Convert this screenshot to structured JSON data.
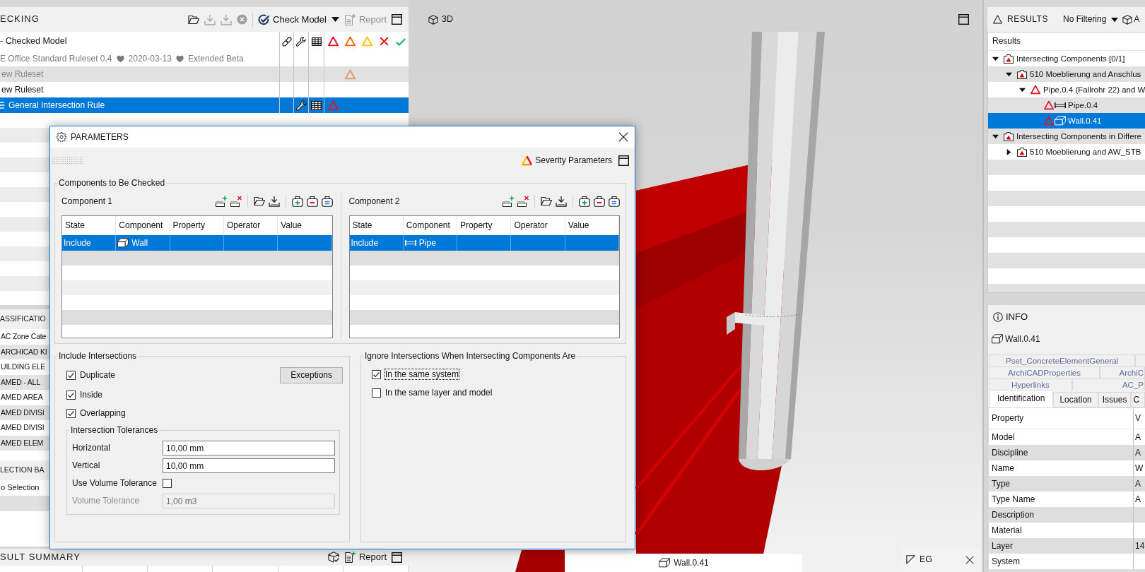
{
  "checking": {
    "title": "ECKING",
    "check_button": "Check Model",
    "report_button": "Report",
    "report_disabled": true,
    "header_label": "- Checked Model",
    "rows": [
      {
        "kind": "info",
        "parts": [
          "E Office Standard Ruleset 0.4",
          "2020-03-13",
          "Extended Beta"
        ],
        "selected": false,
        "disabled": false,
        "configured": false,
        "has_table": false
      },
      {
        "kind": "ruleset",
        "label": "ew Ruleset",
        "selected": false,
        "disabled": true,
        "configured": false,
        "has_table": false,
        "issue": {
          "kind": "warning"
        }
      },
      {
        "kind": "ruleset",
        "label": "ew Ruleset",
        "selected": false,
        "disabled": false,
        "configured": false,
        "has_table": false
      },
      {
        "kind": "rule",
        "label": "General Intersection Rule",
        "selected": true,
        "disabled": false,
        "configured": true,
        "has_table": true,
        "issue": {
          "kind": "error"
        }
      }
    ]
  },
  "classification": {
    "title": "ASSIFICATIO",
    "items": [
      "AC Zone Cate",
      "ARCHICAD KI",
      "UILDING ELE",
      "AMED - ALL",
      "AMED AREA",
      "AMED DIVISI",
      "AMED DIVISI",
      "AMED ELEM"
    ]
  },
  "selection_basket": {
    "title": "LECTION BA",
    "items": [
      "o Selection"
    ]
  },
  "result_summary": {
    "title": "SULT SUMMARY",
    "report_button": "Report"
  },
  "parameters": {
    "title": "PARAMETERS",
    "severity_button": "Severity Parameters",
    "components_title": "Components to Be Checked",
    "components": [
      {
        "title": "Component 1",
        "columns": [
          "State",
          "Component",
          "Property",
          "Operator",
          "Value"
        ],
        "rows": [
          {
            "state": "Include",
            "component": "Wall",
            "kind": "wall",
            "selected": true
          }
        ]
      },
      {
        "title": "Component 2",
        "columns": [
          "State",
          "Component",
          "Property",
          "Operator",
          "Value"
        ],
        "rows": [
          {
            "state": "Include",
            "component": "Pipe",
            "kind": "pipe",
            "selected": true
          }
        ]
      }
    ],
    "include": {
      "title": "Include Intersections",
      "options": [
        {
          "label": "Duplicate",
          "checked": true
        },
        {
          "label": "Inside",
          "checked": true
        },
        {
          "label": "Overlapping",
          "checked": true
        }
      ],
      "exceptions_button": "Exceptions",
      "tolerances": {
        "title": "Intersection Tolerances",
        "fields": [
          {
            "kind": "text",
            "label": "Horizontal",
            "value": "10,00 mm",
            "disabled": false
          },
          {
            "kind": "text",
            "label": "Vertical",
            "value": "10,00 mm",
            "disabled": false
          },
          {
            "kind": "checkbox",
            "label": "Use Volume Tolerance",
            "checked": false,
            "disabled": false
          },
          {
            "kind": "text",
            "label": "Volume Tolerance",
            "value": "1,00 m3",
            "disabled": true
          }
        ]
      }
    },
    "ignore": {
      "title": "Ignore Intersections When Intersecting Components Are",
      "options": [
        {
          "label": "In the same system",
          "checked": true,
          "focused": true
        },
        {
          "label": "In the same layer and model",
          "checked": false,
          "focused": false
        }
      ]
    }
  },
  "viewport": {
    "title": "3D",
    "selection_label": "Wall.0.41",
    "story": "EG"
  },
  "results": {
    "title": "RESULTS",
    "filter": "No Filtering",
    "view_label": "A",
    "column": "Results",
    "tree": [
      {
        "label": "Intersecting Components [0/1]",
        "kind": "group",
        "expanded": true,
        "selected": false,
        "children": [
          {
            "label": "510 Moeblierung and Anschlus",
            "kind": "group",
            "expanded": true,
            "selected": false,
            "children": [
              {
                "label": "Pipe.0.4 (Fallrohr 22) and W",
                "kind": "issue",
                "expanded": true,
                "selected": false,
                "children": [
                  {
                    "label": "Pipe.0.4",
                    "kind": "pipe",
                    "selected": false
                  },
                  {
                    "label": "Wall.0.41",
                    "kind": "wall",
                    "selected": true
                  }
                ]
              }
            ]
          }
        ]
      },
      {
        "label": "Intersecting Components in Differe",
        "kind": "group",
        "expanded": true,
        "selected": false,
        "children": [
          {
            "label": "510 Moeblierung and AW_STB",
            "kind": "group",
            "expanded": false,
            "selected": false
          }
        ]
      }
    ]
  },
  "info": {
    "title": "INFO",
    "object": "Wall.0.41",
    "tab_rows": [
      [
        {
          "label": "Pset_ConcreteElementGeneral",
          "selected": false
        }
      ],
      [
        {
          "label": "ArchiCADProperties",
          "selected": false
        },
        {
          "label": "ArchiC",
          "selected": false
        }
      ],
      [
        {
          "label": "Hyperlinks",
          "selected": false
        },
        {
          "label": "AC_P",
          "selected": false
        }
      ],
      [
        {
          "label": "Identification",
          "selected": true
        },
        {
          "label": "Location",
          "selected": false
        },
        {
          "label": "Issues",
          "selected": false
        },
        {
          "label": "C",
          "selected": false
        }
      ]
    ],
    "columns": [
      "Property",
      "V"
    ],
    "rows": [
      {
        "property": "Model",
        "value": "A"
      },
      {
        "property": "Discipline",
        "value": "A"
      },
      {
        "property": "Name",
        "value": "W"
      },
      {
        "property": "Type",
        "value": "A"
      },
      {
        "property": "Type Name",
        "value": "A"
      },
      {
        "property": "Description"
      },
      {
        "property": "Material"
      },
      {
        "property": "Layer",
        "value": "14"
      },
      {
        "property": "System"
      }
    ]
  }
}
